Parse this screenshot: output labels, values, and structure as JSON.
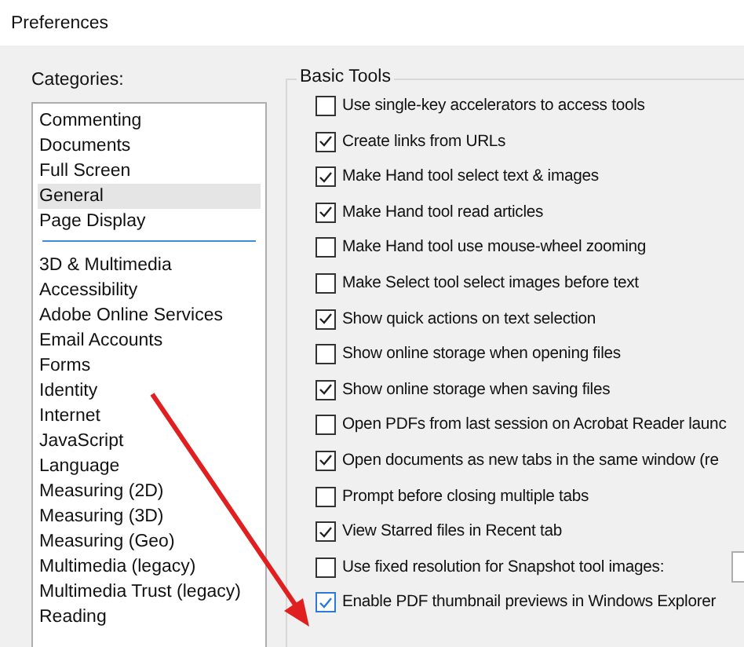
{
  "window": {
    "title": "Preferences"
  },
  "categories": {
    "label": "Categories:",
    "groups": [
      [
        {
          "label": "Commenting",
          "selected": false
        },
        {
          "label": "Documents",
          "selected": false
        },
        {
          "label": "Full Screen",
          "selected": false
        },
        {
          "label": "General",
          "selected": true
        },
        {
          "label": "Page Display",
          "selected": false
        }
      ],
      [
        {
          "label": "3D & Multimedia",
          "selected": false
        },
        {
          "label": "Accessibility",
          "selected": false
        },
        {
          "label": "Adobe Online Services",
          "selected": false
        },
        {
          "label": "Email Accounts",
          "selected": false
        },
        {
          "label": "Forms",
          "selected": false
        },
        {
          "label": "Identity",
          "selected": false
        },
        {
          "label": "Internet",
          "selected": false
        },
        {
          "label": "JavaScript",
          "selected": false
        },
        {
          "label": "Language",
          "selected": false
        },
        {
          "label": "Measuring (2D)",
          "selected": false
        },
        {
          "label": "Measuring (3D)",
          "selected": false
        },
        {
          "label": "Measuring (Geo)",
          "selected": false
        },
        {
          "label": "Multimedia (legacy)",
          "selected": false
        },
        {
          "label": "Multimedia Trust (legacy)",
          "selected": false
        },
        {
          "label": "Reading",
          "selected": false
        }
      ]
    ]
  },
  "basic_tools": {
    "title": "Basic Tools",
    "options": [
      {
        "label": "Use single-key accelerators to access tools",
        "checked": false,
        "focused": false
      },
      {
        "label": "Create links from URLs",
        "checked": true,
        "focused": false
      },
      {
        "label": "Make Hand tool select text & images",
        "checked": true,
        "focused": false
      },
      {
        "label": "Make Hand tool read articles",
        "checked": true,
        "focused": false
      },
      {
        "label": "Make Hand tool use mouse-wheel zooming",
        "checked": false,
        "focused": false
      },
      {
        "label": "Make Select tool select images before text",
        "checked": false,
        "focused": false
      },
      {
        "label": "Show quick actions on text selection",
        "checked": true,
        "focused": false
      },
      {
        "label": "Show online storage when opening files",
        "checked": false,
        "focused": false
      },
      {
        "label": "Show online storage when saving files",
        "checked": true,
        "focused": false
      },
      {
        "label": "Open PDFs from last session on Acrobat Reader launc",
        "checked": false,
        "focused": false
      },
      {
        "label": "Open documents as new tabs in the same window (re",
        "checked": true,
        "focused": false
      },
      {
        "label": "Prompt before closing multiple tabs",
        "checked": false,
        "focused": false
      },
      {
        "label": "View Starred files in Recent tab",
        "checked": true,
        "focused": false
      },
      {
        "label": "Use fixed resolution for Snapshot tool images:",
        "checked": false,
        "focused": false,
        "kind": "field"
      },
      {
        "label": "Enable PDF thumbnail previews in Windows Explorer",
        "checked": true,
        "focused": true
      }
    ]
  }
}
